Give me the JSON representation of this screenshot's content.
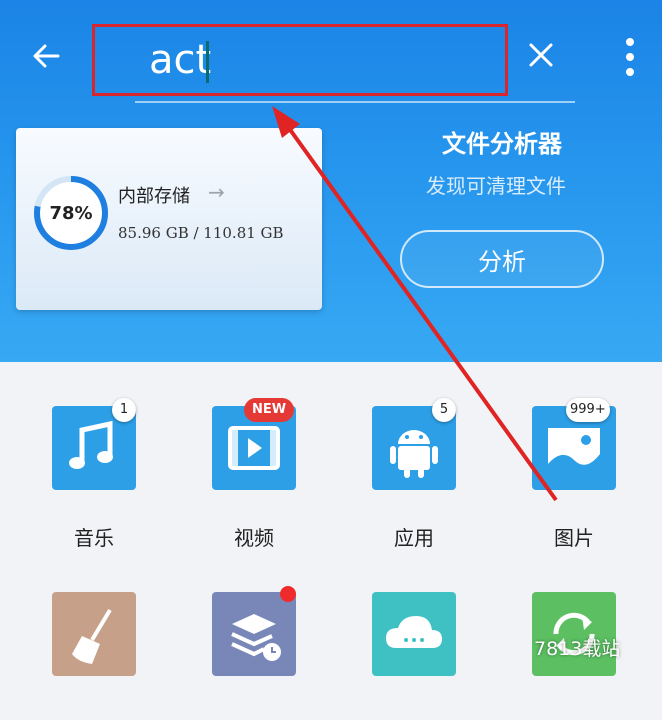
{
  "search": {
    "value": "act"
  },
  "toolbar": {
    "back_icon": "arrow-left-icon",
    "clear_icon": "close-icon",
    "menu_icon": "more-vert-icon"
  },
  "storage": {
    "title": "内部存储",
    "percent_label": "78%",
    "percent_value": 0.78,
    "size_text": "85.96 GB / 110.81 GB"
  },
  "analyzer": {
    "title": "文件分析器",
    "subtitle": "发现可清理文件",
    "button_label": "分析"
  },
  "categories": [
    {
      "label": "音乐",
      "badge": "1",
      "icon": "music-note-icon"
    },
    {
      "label": "视频",
      "badge": "NEW",
      "icon": "video-play-icon"
    },
    {
      "label": "应用",
      "badge": "5",
      "icon": "android-icon"
    },
    {
      "label": "图片",
      "badge": "999+",
      "icon": "image-icon"
    }
  ],
  "tools": [
    {
      "icon": "broom-icon"
    },
    {
      "icon": "stack-clock-icon"
    },
    {
      "icon": "cloud-icon"
    },
    {
      "icon": "sync-icon"
    }
  ],
  "watermark": "7813载站",
  "colors": {
    "header_blue": "#2797ee",
    "highlight_red": "#d9262c",
    "badge_red": "#e53935"
  }
}
